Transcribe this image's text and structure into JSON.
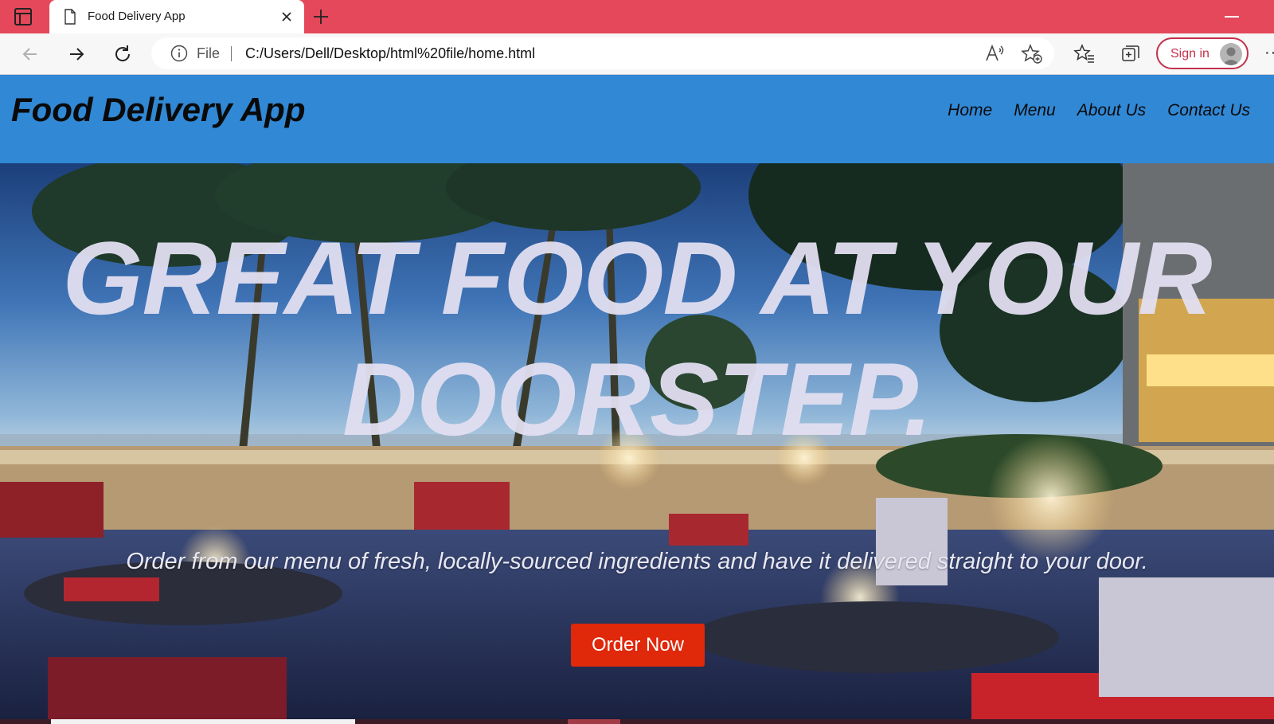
{
  "browser": {
    "tab_title": "Food Delivery App",
    "address_prefix": "File",
    "url": "C:/Users/Dell/Desktop/html%20file/home.html",
    "sign_in_label": "Sign in",
    "more_label": "···",
    "accent_color": "#e4485a"
  },
  "site": {
    "title": "Food Delivery App",
    "nav": [
      "Home",
      "Menu",
      "About Us",
      "Contact Us"
    ],
    "header_color": "#3188d5"
  },
  "hero": {
    "headline": "GREAT FOOD AT YOUR DOORSTEP.",
    "subtitle": "Order from our menu of fresh, locally-sourced ingredients and have it delivered straight to your door.",
    "cta_label": "Order Now",
    "cta_color": "#e0280a"
  }
}
